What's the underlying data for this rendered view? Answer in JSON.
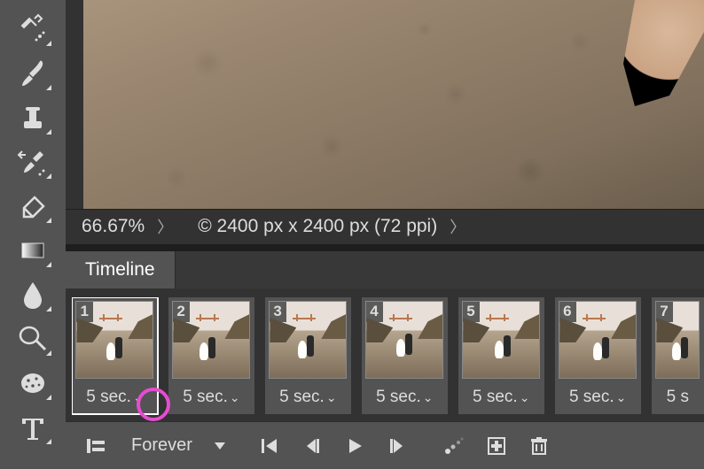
{
  "status": {
    "zoom": "66.67%",
    "doc_info": "© 2400 px x 2400 px (72 ppi)"
  },
  "panel": {
    "tab": "Timeline"
  },
  "frames": [
    {
      "num": "1",
      "delay": "5 sec."
    },
    {
      "num": "2",
      "delay": "5 sec."
    },
    {
      "num": "3",
      "delay": "5 sec."
    },
    {
      "num": "4",
      "delay": "5 sec."
    },
    {
      "num": "5",
      "delay": "5 sec."
    },
    {
      "num": "6",
      "delay": "5 sec."
    },
    {
      "num": "7",
      "delay": "5 s"
    }
  ],
  "loop": {
    "label": "Forever"
  },
  "tools": [
    "healing-brush-icon",
    "brush-icon",
    "clone-stamp-icon",
    "history-brush-icon",
    "eraser-icon",
    "gradient-icon",
    "blur-icon",
    "dodge-icon",
    "sponge-icon",
    "type-icon"
  ]
}
